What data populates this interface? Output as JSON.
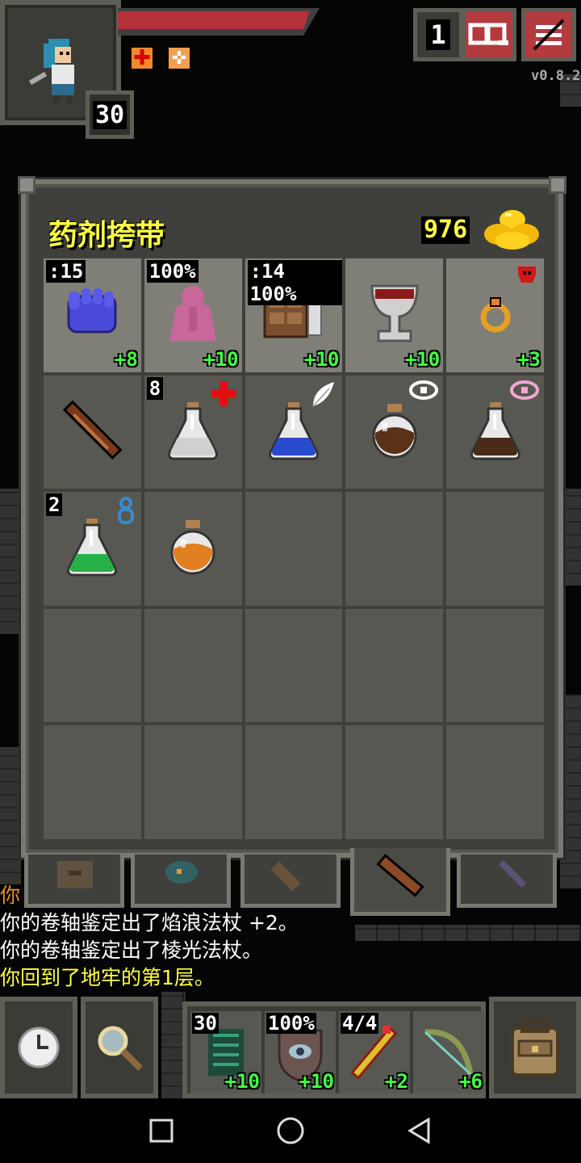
{
  "hero": {
    "level": "30",
    "hp_fraction": 0.95,
    "buffs": [
      "regeneration-buff-icon",
      "bless-buff-icon"
    ]
  },
  "controls": {
    "depth": "1",
    "journal_icon": "journal-icon",
    "menu_icon": "menu-icon",
    "version": "v0.8.2"
  },
  "inventory": {
    "title": "药剂挎带",
    "gold": "976",
    "slots": [
      {
        "icon": "gloves-icon",
        "tl": ":15",
        "br": "+8",
        "equipped": true
      },
      {
        "icon": "cloak-icon",
        "tl": "100%",
        "br": "+10",
        "equipped": true
      },
      {
        "icon": "spellbook-icon",
        "tl": ":14 100%",
        "br": "+10",
        "equipped": true
      },
      {
        "icon": "chalice-icon",
        "tl": "",
        "br": "+10",
        "equipped": true
      },
      {
        "icon": "ring-icon",
        "tl": "",
        "br": "+3",
        "equipped": true,
        "tr": "red-mark-icon"
      },
      {
        "icon": "wand-icon",
        "tl": "",
        "br": "",
        "equipped": false
      },
      {
        "icon": "potion-white-icon",
        "tl": "8",
        "br": "",
        "equipped": false,
        "tr": "healing-cross-icon"
      },
      {
        "icon": "potion-blue-icon",
        "tl": "",
        "br": "",
        "equipped": false,
        "tr": "feather-icon"
      },
      {
        "icon": "potion-brown-icon",
        "tl": "",
        "br": "",
        "equipped": false,
        "tr": "eye-icon"
      },
      {
        "icon": "potion-dark-icon",
        "tl": "",
        "br": "",
        "equipped": false,
        "tr": "pink-eye-icon"
      },
      {
        "icon": "potion-green-icon",
        "tl": "2",
        "br": "",
        "equipped": false,
        "tr": "blue-figure-icon"
      },
      {
        "icon": "potion-orange-icon",
        "tl": "",
        "br": "",
        "equipped": false
      },
      {
        "icon": "",
        "tl": "",
        "br": "",
        "equipped": false
      },
      {
        "icon": "",
        "tl": "",
        "br": "",
        "equipped": false
      },
      {
        "icon": "",
        "tl": "",
        "br": "",
        "equipped": false
      },
      {
        "icon": "",
        "tl": "",
        "br": "",
        "equipped": false
      },
      {
        "icon": "",
        "tl": "",
        "br": "",
        "equipped": false
      },
      {
        "icon": "",
        "tl": "",
        "br": "",
        "equipped": false
      },
      {
        "icon": "",
        "tl": "",
        "br": "",
        "equipped": false
      },
      {
        "icon": "",
        "tl": "",
        "br": "",
        "equipped": false
      },
      {
        "icon": "",
        "tl": "",
        "br": "",
        "equipped": false
      },
      {
        "icon": "",
        "tl": "",
        "br": "",
        "equipped": false
      },
      {
        "icon": "",
        "tl": "",
        "br": "",
        "equipped": false
      },
      {
        "icon": "",
        "tl": "",
        "br": "",
        "equipped": false
      },
      {
        "icon": "",
        "tl": "",
        "br": "",
        "equipped": false
      }
    ]
  },
  "tabs": [
    "backpack-tab-icon",
    "seed-pouch-tab-icon",
    "scroll-holder-tab-icon",
    "wand-holster-tab-icon",
    "dagger-tab-icon"
  ],
  "log": {
    "line0": "你",
    "line1": "你的卷轴鉴定出了焰浪法杖 +2。",
    "line2": "你的卷轴鉴定出了棱光法杖。",
    "line3": "你回到了地牢的第1层。",
    "line3_color": "#ffff44"
  },
  "toolbar": {
    "wait_icon": "clock-icon",
    "search_icon": "magnifier-icon",
    "quickslots": [
      {
        "icon": "armor-icon",
        "tl": "30",
        "br": "+10"
      },
      {
        "icon": "shield-icon",
        "tl": "100%",
        "br": "+10"
      },
      {
        "icon": "wand-fire-icon",
        "tl": "4/4",
        "br": "+2"
      },
      {
        "icon": "bow-icon",
        "tl": "",
        "br": "+6"
      }
    ],
    "backpack_icon": "backpack-icon"
  },
  "nav": [
    "recent-apps-icon",
    "home-icon",
    "back-icon"
  ],
  "colors": {
    "gold_text": "#ffff44",
    "bonus_green": "#44ff44",
    "hp_red": "#b3323a",
    "panel": "#3f403c"
  }
}
